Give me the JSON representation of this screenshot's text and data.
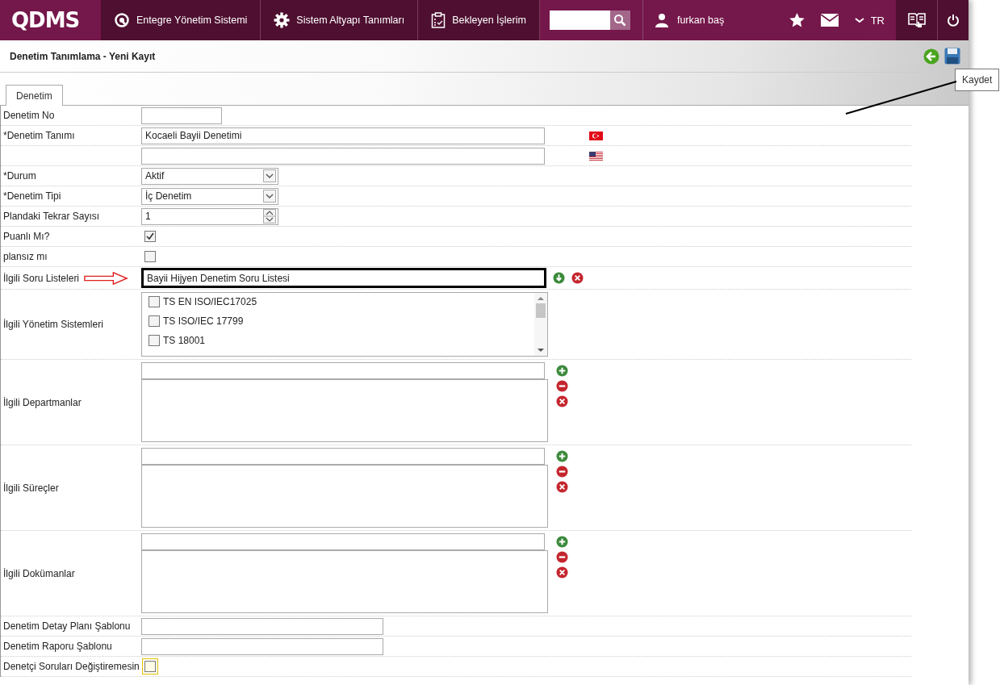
{
  "nav": {
    "logo": "QDMS",
    "items": [
      {
        "label": "Entegre Yönetim Sistemi",
        "kind": "q"
      },
      {
        "label": "Sistem Altyapı Tanımları",
        "kind": "gear"
      },
      {
        "label": "Bekleyen İşlerim",
        "kind": "clipboard"
      }
    ],
    "user": "furkan baş",
    "language": "TR"
  },
  "page": {
    "title": "Denetim Tanımlama - Yeni Kayıt",
    "tooltip": "Kaydet"
  },
  "tabs": [
    {
      "label": "Denetim",
      "selected": true
    }
  ],
  "fields": [
    {
      "kind": "code",
      "label": "Denetim No"
    },
    {
      "kind": "localized_tr",
      "label": "*Denetim Tanımı",
      "value": "Kocaeli Bayii Denetimi"
    },
    {
      "kind": "localized_us"
    },
    {
      "kind": "select",
      "label": "*Durum",
      "value": "Aktif"
    },
    {
      "kind": "select",
      "label": "*Denetim Tipi",
      "value": "İç Denetim"
    },
    {
      "kind": "number",
      "label": "Plandaki Tekrar Sayısı",
      "value": "1"
    },
    {
      "kind": "checkbox",
      "label": "Puanlı Mı?",
      "checked": true
    },
    {
      "kind": "checkbox",
      "label": "plansız mı",
      "checked": false
    },
    {
      "kind": "lookup",
      "label": "İlgili Soru Listeleri",
      "value": "Bayii Hijyen Denetim Soru Listesi",
      "highlighted": true
    },
    {
      "kind": "checklist",
      "label": "İlgili Yönetim Sistemleri",
      "options": [
        {
          "label": "TS EN ISO/IEC17025",
          "checked": false
        },
        {
          "label": "TS ISO/IEC 17799",
          "checked": false
        },
        {
          "label": "TS 18001",
          "checked": false
        }
      ]
    },
    {
      "kind": "picker",
      "label": "İlgili Departmanlar"
    },
    {
      "kind": "picker",
      "label": "İlgili Süreçler"
    },
    {
      "kind": "picker",
      "label": "İlgili Dokümanlar"
    },
    {
      "kind": "template",
      "label": "Denetim Detay Planı Şablonu"
    },
    {
      "kind": "template",
      "label": "Denetim Raporu Şablonu"
    },
    {
      "kind": "checkbox",
      "label": "Denetçi Soruları Değiştiremesin",
      "checked": false,
      "focused": true
    }
  ]
}
